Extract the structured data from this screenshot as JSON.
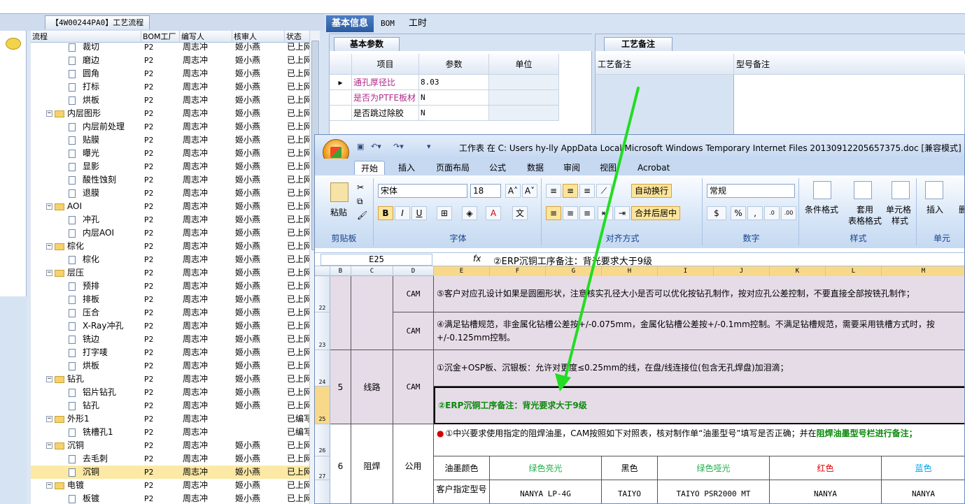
{
  "left": {
    "tab_title": "【4W00244PA0】工艺流程",
    "columns": [
      "流程",
      "BOM工厂",
      "编写人",
      "核审人",
      "状态"
    ],
    "rows": [
      {
        "name": "裁切",
        "level": 2,
        "bom": "P2",
        "writer": "周志冲",
        "reviewer": "姬小燕",
        "status": "已上网"
      },
      {
        "name": "磨边",
        "level": 2,
        "bom": "P2",
        "writer": "周志冲",
        "reviewer": "姬小燕",
        "status": "已上网"
      },
      {
        "name": "圆角",
        "level": 2,
        "bom": "P2",
        "writer": "周志冲",
        "reviewer": "姬小燕",
        "status": "已上网"
      },
      {
        "name": "打标",
        "level": 2,
        "bom": "P2",
        "writer": "周志冲",
        "reviewer": "姬小燕",
        "status": "已上网"
      },
      {
        "name": "烘板",
        "level": 2,
        "bom": "P2",
        "writer": "周志冲",
        "reviewer": "姬小燕",
        "status": "已上网"
      },
      {
        "name": "内层图形",
        "level": 1,
        "bom": "P2",
        "writer": "周志冲",
        "reviewer": "姬小燕",
        "status": "已上网"
      },
      {
        "name": "内层前处理",
        "level": 2,
        "bom": "P2",
        "writer": "周志冲",
        "reviewer": "姬小燕",
        "status": "已上网"
      },
      {
        "name": "贴膜",
        "level": 2,
        "bom": "P2",
        "writer": "周志冲",
        "reviewer": "姬小燕",
        "status": "已上网"
      },
      {
        "name": "曝光",
        "level": 2,
        "bom": "P2",
        "writer": "周志冲",
        "reviewer": "姬小燕",
        "status": "已上网"
      },
      {
        "name": "显影",
        "level": 2,
        "bom": "P2",
        "writer": "周志冲",
        "reviewer": "姬小燕",
        "status": "已上网"
      },
      {
        "name": "酸性蚀刻",
        "level": 2,
        "bom": "P2",
        "writer": "周志冲",
        "reviewer": "姬小燕",
        "status": "已上网"
      },
      {
        "name": "退膜",
        "level": 2,
        "bom": "P2",
        "writer": "周志冲",
        "reviewer": "姬小燕",
        "status": "已上网"
      },
      {
        "name": "AOI",
        "level": 1,
        "bom": "P2",
        "writer": "周志冲",
        "reviewer": "姬小燕",
        "status": "已上网"
      },
      {
        "name": "冲孔",
        "level": 2,
        "bom": "P2",
        "writer": "周志冲",
        "reviewer": "姬小燕",
        "status": "已上网"
      },
      {
        "name": "内层AOI",
        "level": 2,
        "bom": "P2",
        "writer": "周志冲",
        "reviewer": "姬小燕",
        "status": "已上网"
      },
      {
        "name": "棕化",
        "level": 1,
        "bom": "P2",
        "writer": "周志冲",
        "reviewer": "姬小燕",
        "status": "已上网"
      },
      {
        "name": "棕化",
        "level": 2,
        "bom": "P2",
        "writer": "周志冲",
        "reviewer": "姬小燕",
        "status": "已上网"
      },
      {
        "name": "层压",
        "level": 1,
        "bom": "P2",
        "writer": "周志冲",
        "reviewer": "姬小燕",
        "status": "已上网"
      },
      {
        "name": "预排",
        "level": 2,
        "bom": "P2",
        "writer": "周志冲",
        "reviewer": "姬小燕",
        "status": "已上网"
      },
      {
        "name": "排板",
        "level": 2,
        "bom": "P2",
        "writer": "周志冲",
        "reviewer": "姬小燕",
        "status": "已上网"
      },
      {
        "name": "压合",
        "level": 2,
        "bom": "P2",
        "writer": "周志冲",
        "reviewer": "姬小燕",
        "status": "已上网"
      },
      {
        "name": "X-Ray冲孔",
        "level": 2,
        "bom": "P2",
        "writer": "周志冲",
        "reviewer": "姬小燕",
        "status": "已上网"
      },
      {
        "name": "铣边",
        "level": 2,
        "bom": "P2",
        "writer": "周志冲",
        "reviewer": "姬小燕",
        "status": "已上网"
      },
      {
        "name": "打字唛",
        "level": 2,
        "bom": "P2",
        "writer": "周志冲",
        "reviewer": "姬小燕",
        "status": "已上网"
      },
      {
        "name": "烘板",
        "level": 2,
        "bom": "P2",
        "writer": "周志冲",
        "reviewer": "姬小燕",
        "status": "已上网"
      },
      {
        "name": "钻孔",
        "level": 1,
        "bom": "P2",
        "writer": "周志冲",
        "reviewer": "姬小燕",
        "status": "已上网"
      },
      {
        "name": "铝片钻孔",
        "level": 2,
        "bom": "P2",
        "writer": "周志冲",
        "reviewer": "姬小燕",
        "status": "已上网"
      },
      {
        "name": "钻孔",
        "level": 2,
        "bom": "P2",
        "writer": "周志冲",
        "reviewer": "姬小燕",
        "status": "已上网"
      },
      {
        "name": "外形1",
        "level": 1,
        "bom": "P2",
        "writer": "周志冲",
        "reviewer": "",
        "status": "已编写"
      },
      {
        "name": "铣槽孔1",
        "level": 2,
        "bom": "P2",
        "writer": "周志冲",
        "reviewer": "",
        "status": "已编写"
      },
      {
        "name": "沉铜",
        "level": 1,
        "bom": "P2",
        "writer": "周志冲",
        "reviewer": "姬小燕",
        "status": "已上网"
      },
      {
        "name": "去毛刺",
        "level": 2,
        "bom": "P2",
        "writer": "周志冲",
        "reviewer": "姬小燕",
        "status": "已上网"
      },
      {
        "name": "沉铜",
        "level": 2,
        "bom": "P2",
        "writer": "周志冲",
        "reviewer": "姬小燕",
        "status": "已上网",
        "selected": true
      },
      {
        "name": "电镀",
        "level": 1,
        "bom": "P2",
        "writer": "周志冲",
        "reviewer": "姬小燕",
        "status": "已上网"
      },
      {
        "name": "板镀",
        "level": 2,
        "bom": "P2",
        "writer": "周志冲",
        "reviewer": "姬小燕",
        "status": "已上网"
      }
    ]
  },
  "right": {
    "tabs": [
      "基本信息",
      "BOM",
      "工时"
    ],
    "params_tab": "基本参数",
    "param_cols": [
      "项目",
      "参数",
      "单位"
    ],
    "params": [
      {
        "item": "通孔厚径比",
        "value": "8.03",
        "unit": ""
      },
      {
        "item": "是否为PTFE板材",
        "value": "N",
        "unit": ""
      },
      {
        "item": "是否跳过除胶",
        "value": "N",
        "unit": ""
      }
    ],
    "notes_tab": "工艺备注",
    "notes_cols": [
      "工艺备注",
      "型号备注"
    ]
  },
  "excel": {
    "title": "工作表 在 C: Users hy-lly AppData Local Microsoft Windows Temporary Internet Files 20130912205657375.doc [兼容模式] - M",
    "menu": [
      "开始",
      "插入",
      "页面布局",
      "公式",
      "数据",
      "审阅",
      "视图",
      "Acrobat"
    ],
    "font_name": "宋体",
    "font_size": "18",
    "number_format": "常规",
    "btn_paste": "粘贴",
    "btn_wrap": "自动换行",
    "btn_merge": "合并后居中",
    "btn_cond": "条件格式",
    "btn_table_1": "套用",
    "btn_table_2": "表格格式",
    "btn_cellstyle_1": "单元格",
    "btn_cellstyle_2": "样式",
    "btn_insert": "插入",
    "btn_delete": "删",
    "groups": [
      "剪贴板",
      "字体",
      "对齐方式",
      "数字",
      "样式",
      "单元"
    ],
    "namebox": "E25",
    "formula": "②ERP沉铜工序备注：背光要求大于9级",
    "columns": [
      "B",
      "C",
      "D",
      "E",
      "F",
      "G",
      "H",
      "I",
      "J",
      "K",
      "L",
      "M"
    ],
    "rows": {
      "r22": {
        "num": "22",
        "c2": "CAM",
        "note": "⑤客户对应孔设计如果是圆圈形状，注意核实孔径大小是否可以优化按钻孔制作，按对应孔公差控制，不要直接全部按铣孔制作；"
      },
      "r23": {
        "num": "23",
        "c2": "CAM",
        "note": "④满足钻槽规范，非金属化钻槽公差按+/-0.075mm，金属化钻槽公差按+/-0.1mm控制。不满足钻槽规范，需要采用铣槽方式时，按+/-0.125mm控制。"
      },
      "r24": {
        "num": "24",
        "seq": "5",
        "proc": "线路",
        "c2": "CAM",
        "note": "①沉金+OSP板、沉银板：允许对更度≤0.25mm的线，在盘/线连接位(包含无孔焊盘)加泪滴；"
      },
      "r25": {
        "num": "25",
        "note": "②ERP沉铜工序备注：背光要求大于9级"
      },
      "r26": {
        "num": "26",
        "seq": "6",
        "proc": "阻焊",
        "c2": "公用",
        "note_a": "①中兴要求使用指定的阻焊油墨，CAM按照如下对照表，核对制作单“油墨型号”填写是否正确；并在",
        "note_b": "阻焊油墨型号栏进行备注；"
      },
      "r27": {
        "num": "27",
        "label": "油墨颜色",
        "colors": [
          "绿色亮光",
          "黑色",
          "绿色哑光",
          "红色",
          "蓝色"
        ]
      },
      "r28": {
        "label": "客户指定型号",
        "models": [
          "NANYA  LP-4G",
          "TAIYO",
          "TAIYO  PSR2000 MT",
          "NANYA",
          "NANYA"
        ]
      }
    }
  },
  "colors": {
    "accent": "#2a5aa2",
    "arrow": "#22dd22",
    "selection": "#fce9a6"
  }
}
